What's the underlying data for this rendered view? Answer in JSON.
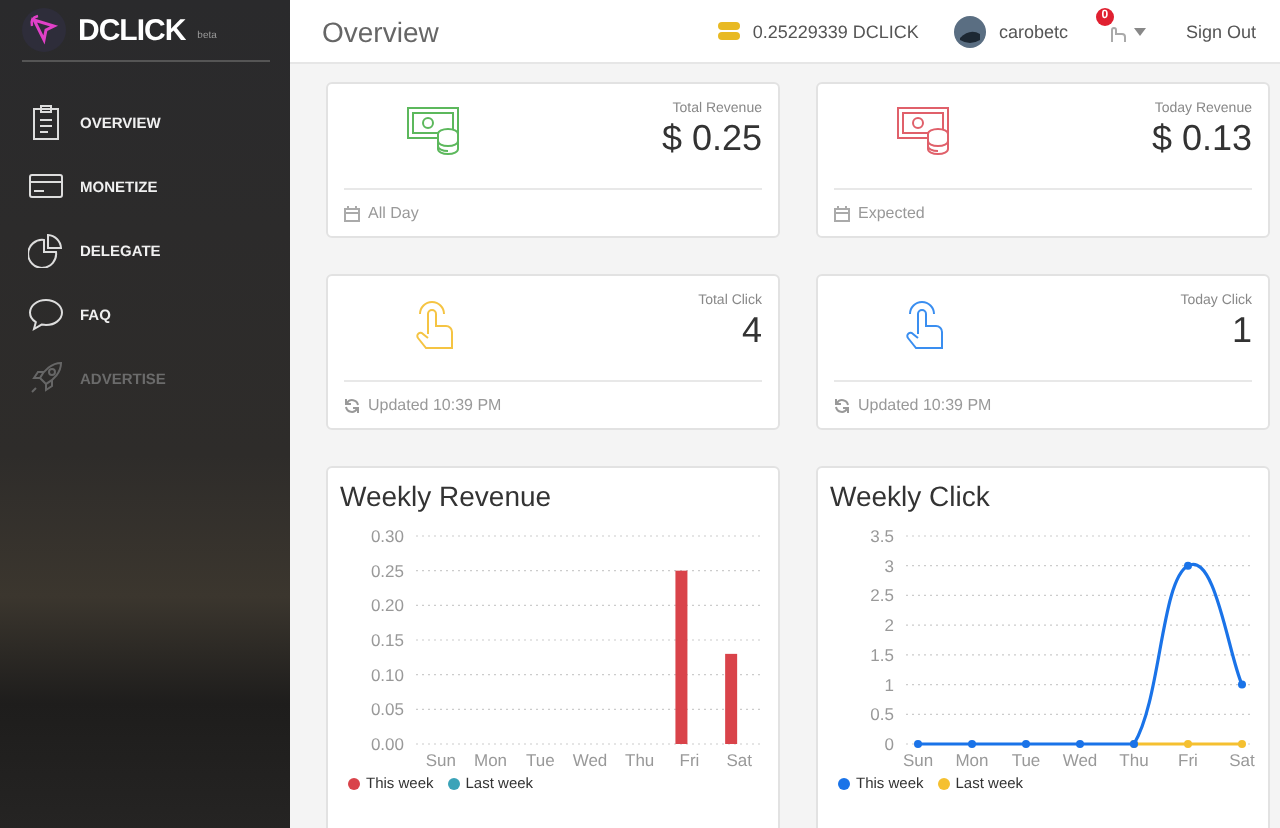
{
  "brand": {
    "name": "DCLICK",
    "tag": "beta"
  },
  "nav": [
    {
      "kind": "clipboard",
      "label": "OVERVIEW",
      "disabled": false
    },
    {
      "kind": "card",
      "label": "MONETIZE",
      "disabled": false
    },
    {
      "kind": "pie",
      "label": "DELEGATE",
      "disabled": false
    },
    {
      "kind": "bubble",
      "label": "FAQ",
      "disabled": false
    },
    {
      "kind": "rocket",
      "label": "ADVERTISE",
      "disabled": true
    }
  ],
  "header": {
    "title": "Overview",
    "balance": "0.25229339 DCLICK",
    "user": "carobetc",
    "notifications": "0",
    "sign_out": "Sign Out"
  },
  "stats": [
    {
      "kind": "money",
      "color": "#5cb85c",
      "label": "Total Revenue",
      "value": "$ 0.25",
      "footer": {
        "kind": "calendar",
        "text": "All Day"
      }
    },
    {
      "kind": "money",
      "color": "#e0606a",
      "label": "Today Revenue",
      "value": "$ 0.13",
      "footer": {
        "kind": "calendar",
        "text": "Expected"
      }
    },
    {
      "kind": "click",
      "color": "#f5c443",
      "label": "Total Click",
      "value": "4",
      "footer": {
        "kind": "refresh",
        "text": "Updated 10:39 PM"
      }
    },
    {
      "kind": "click",
      "color": "#3a8ef0",
      "label": "Today Click",
      "value": "1",
      "footer": {
        "kind": "refresh",
        "text": "Updated 10:39 PM"
      }
    }
  ],
  "charts": [
    {
      "chart_data": {
        "type": "bar",
        "title": "Weekly Revenue",
        "grid": true,
        "categories": [
          "Sun",
          "Mon",
          "Tue",
          "Wed",
          "Thu",
          "Fri",
          "Sat"
        ],
        "series": [
          {
            "name": "This week",
            "color": "#d9434a",
            "values": [
              0,
              0,
              0,
              0,
              0,
              0.25,
              0.13
            ]
          },
          {
            "name": "Last week",
            "color": "#3ba3b8",
            "values": [
              0,
              0,
              0,
              0,
              0,
              0,
              0
            ]
          }
        ],
        "ylim": [
          0,
          0.3
        ],
        "yticks": [
          {
            "value": 0,
            "label": "0.00"
          },
          {
            "value": 0.05,
            "label": "0.05"
          },
          {
            "value": 0.1,
            "label": "0.10"
          },
          {
            "value": 0.15,
            "label": "0.15"
          },
          {
            "value": 0.2,
            "label": "0.20"
          },
          {
            "value": 0.25,
            "label": "0.25"
          },
          {
            "value": 0.3,
            "label": "0.30"
          }
        ]
      }
    },
    {
      "chart_data": {
        "type": "line",
        "title": "Weekly Click",
        "grid": true,
        "categories": [
          "Sun",
          "Mon",
          "Tue",
          "Wed",
          "Thu",
          "Fri",
          "Sat"
        ],
        "series": [
          {
            "name": "This week",
            "color": "#1a73e8",
            "marker": true,
            "values": [
              0,
              0,
              0,
              0,
              0,
              3,
              1
            ]
          },
          {
            "name": "Last week",
            "color": "#f5c030",
            "marker": true,
            "values": [
              null,
              null,
              null,
              null,
              0,
              0,
              0
            ]
          }
        ],
        "ylim": [
          0,
          3.5
        ],
        "yticks": [
          0,
          0.5,
          1,
          1.5,
          2,
          2.5,
          3,
          3.5
        ]
      }
    }
  ]
}
